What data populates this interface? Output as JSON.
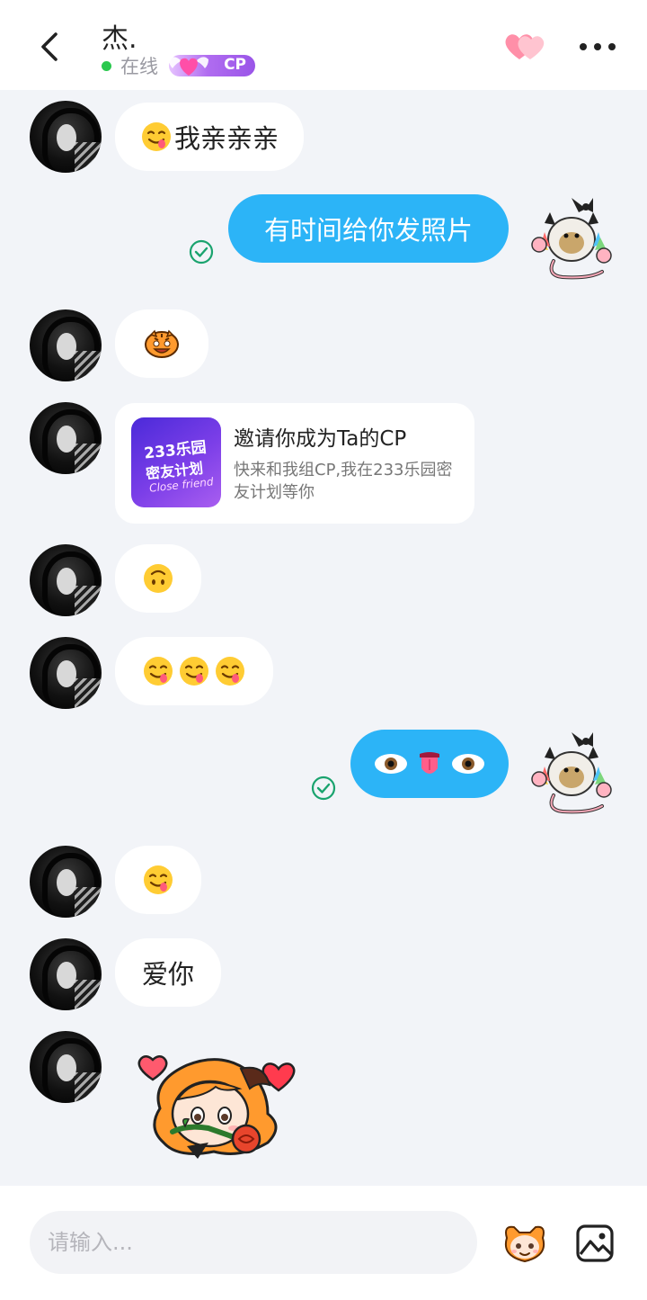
{
  "header": {
    "title": "杰.",
    "status": "在线",
    "cp_label": "CP"
  },
  "messages": [
    {
      "from": "them",
      "type": "text",
      "emoji": "face-savoring-food",
      "text": "我亲亲亲"
    },
    {
      "from": "me",
      "type": "text",
      "text": "有时间给你发照片",
      "read": true
    },
    {
      "from": "them",
      "type": "emoji",
      "emoji": "tiger-sticker-emoji"
    },
    {
      "from": "them",
      "type": "card",
      "title": "邀请你成为Ta的CP",
      "desc": "快来和我组CP,我在233乐园密友计划等你",
      "thumb_line1": "233乐园",
      "thumb_line2": "密友计划",
      "thumb_line3": "Close friend"
    },
    {
      "from": "them",
      "type": "emoji",
      "emoji": "upside-down-face"
    },
    {
      "from": "them",
      "type": "emoji",
      "emoji": "face-savoring-food x3"
    },
    {
      "from": "me",
      "type": "emoji",
      "emoji": "eyes-tongue-eyes",
      "read": true
    },
    {
      "from": "them",
      "type": "emoji",
      "emoji": "face-savoring-food"
    },
    {
      "from": "them",
      "type": "text",
      "text": "爱你"
    },
    {
      "from": "them",
      "type": "sticker",
      "emoji": "girl-with-rose-sticker"
    }
  ],
  "input": {
    "placeholder": "请输入..."
  },
  "colors": {
    "accent_blue": "#2cb4f7",
    "online_green": "#2ac84e",
    "read_check_green": "#1aa36e",
    "background": "#f2f4f8"
  }
}
